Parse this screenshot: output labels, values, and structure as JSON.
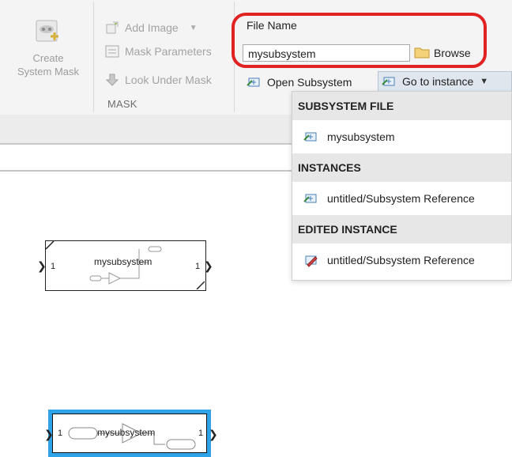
{
  "ribbon": {
    "create_label_line1": "Create",
    "create_label_line2": "System Mask",
    "add_image": "Add Image",
    "mask_parameters": "Mask Parameters",
    "look_under_mask": "Look Under Mask",
    "mask_group": "MASK",
    "file_name_label": "File Name",
    "file_name_value": "mysubsystem",
    "browse": "Browse",
    "open_subsystem": "Open Subsystem",
    "go_to_instance": "Go to instance"
  },
  "dropdown": {
    "subsystem_file_header": "SUBSYSTEM FILE",
    "subsystem_file_item": "mysubsystem",
    "instances_header": "INSTANCES",
    "instance_item": "untitled/Subsystem Reference",
    "edited_instance_header": "EDITED INSTANCE",
    "edited_instance_item": "untitled/Subsystem Reference"
  },
  "canvas": {
    "block1": {
      "name": "mysubsystem",
      "in_port": "1",
      "out_port": "1"
    },
    "block2": {
      "name": "mysubsystem",
      "in_port": "1",
      "out_port": "1",
      "selected": true
    }
  },
  "colors": {
    "highlight": "#e02222",
    "selection": "#2ea3e8",
    "ribbon_bg": "#f4f4f4",
    "dropdown_header_bg": "#e7e7e7"
  },
  "icons": [
    "create-system-mask-icon",
    "add-image-icon",
    "mask-parameters-icon",
    "look-under-mask-icon",
    "folder-icon",
    "open-subsystem-icon",
    "subsystem-reference-icon",
    "edit-subsystem-icon",
    "chevron-down-icon"
  ]
}
